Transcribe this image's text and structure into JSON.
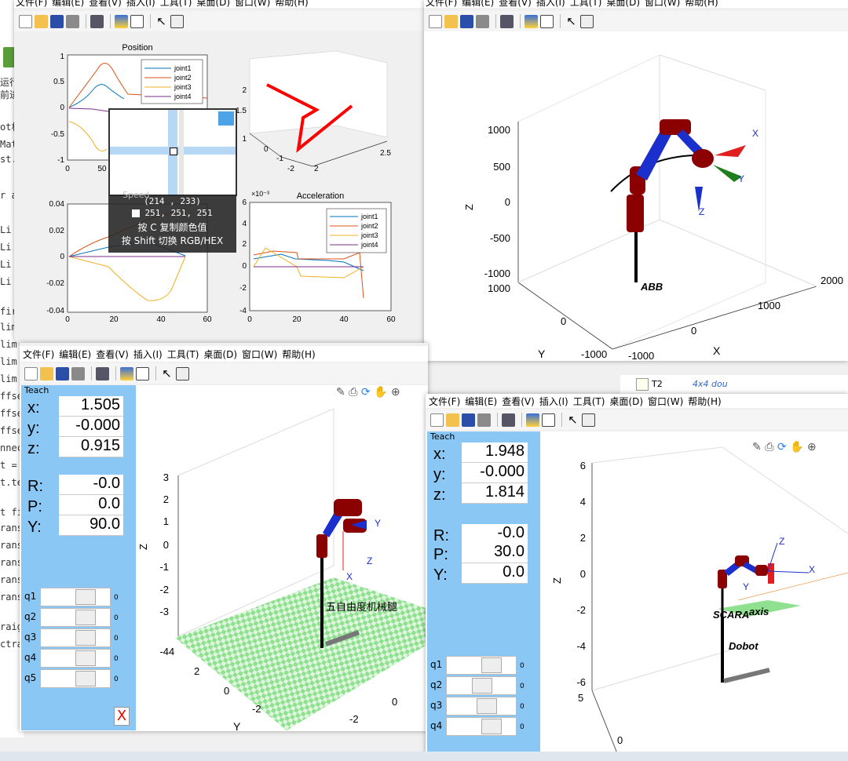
{
  "menu": [
    "文件(F)",
    "编辑(E)",
    "查看(V)",
    "插入(I)",
    "工具(T)",
    "桌面(D)",
    "窗口(W)",
    "帮助(H)"
  ],
  "code_lines": [
    {
      "text": "运行",
      "top": 96
    },
    {
      "text": "前进",
      "top": 112
    },
    {
      "text": "ot机",
      "top": 153
    },
    {
      "text": "Mat",
      "top": 177
    },
    {
      "text": "st.m",
      "top": 196
    },
    {
      "text": "r a",
      "top": 242
    },
    {
      "text": "Li",
      "top": 286
    },
    {
      "text": "Li",
      "top": 308
    },
    {
      "text": "Li",
      "top": 330
    },
    {
      "text": "Li",
      "top": 352
    },
    {
      "text": "fir",
      "top": 390
    },
    {
      "text": "lim",
      "top": 410
    },
    {
      "text": "lim",
      "top": 432
    },
    {
      "text": "lim",
      "top": 454
    },
    {
      "text": "lim",
      "top": 476
    },
    {
      "text": "ffse",
      "top": 498
    },
    {
      "text": "ffse",
      "top": 520
    },
    {
      "text": "ffse",
      "top": 542
    },
    {
      "text": "nnec",
      "top": 564
    },
    {
      "text": "t =",
      "top": 586
    },
    {
      "text": "t.te",
      "top": 608
    },
    {
      "text": "t fi",
      "top": 646
    },
    {
      "text": "rans",
      "top": 666
    },
    {
      "text": "rans",
      "top": 688
    },
    {
      "text": "rans",
      "top": 710
    },
    {
      "text": "rans",
      "top": 732
    },
    {
      "text": "rans",
      "top": 754
    },
    {
      "text": "raig",
      "top": 792
    },
    {
      "text": "ctra",
      "top": 814
    }
  ],
  "workspace": {
    "row1": "T2",
    "row2": "4x4 dou"
  },
  "tooltip": {
    "coords": "(214 , 233)",
    "rgb": "251, 251, 251",
    "line1": "按 C 复制颜色值",
    "line2": "按 Shift 切换 RGB/HEX"
  },
  "plots": {
    "position": {
      "title": "Position",
      "yticks": [
        "1",
        "0.5",
        "0",
        "-0.5",
        "-1"
      ],
      "xticks": [
        "0",
        "50"
      ]
    },
    "speed": {
      "title": "Speed",
      "yticks": [
        "0.04",
        "0.02",
        "0",
        "-0.02",
        "-0.04"
      ],
      "xticks": [
        "0",
        "20",
        "40",
        "60"
      ]
    },
    "accel": {
      "title": "Acceleration",
      "exp": "×10⁻³",
      "yticks": [
        "6",
        "4",
        "2",
        "0",
        "-2",
        "-4"
      ],
      "xticks": [
        "0",
        "20",
        "40",
        "60"
      ]
    },
    "legend": [
      "joint1",
      "joint2",
      "joint3",
      "joint4"
    ],
    "path3d": {
      "zticks": [
        "2",
        "1.5",
        "1"
      ],
      "xticks": [
        "0",
        "-1",
        "-2"
      ],
      "yticks": [
        "2",
        "2.5"
      ]
    }
  },
  "abb": {
    "zticks": [
      "1000",
      "500",
      "0",
      "-500",
      "-1000"
    ],
    "ylabel": "Y",
    "zlabel": "Z",
    "xlabel": "X",
    "yticks": [
      "1000",
      "0",
      "-1000"
    ],
    "xticks": [
      "-1000",
      "0",
      "1000",
      "2000"
    ],
    "name": "ABB",
    "axes": [
      "X",
      "Y",
      "Z"
    ]
  },
  "leg": {
    "teach_title": "Teach",
    "x": "1.505",
    "y": "-0.000",
    "z": "0.915",
    "R": "-0.0",
    "P": "0.0",
    "Yv": "90.0",
    "q": [
      "q1",
      "q2",
      "q3",
      "q4",
      "q5"
    ],
    "qval": "0",
    "close": "X",
    "zticks": [
      "3",
      "2",
      "1",
      "0",
      "-1",
      "-2",
      "-3",
      "-4"
    ],
    "ticks_a": [
      "4",
      "2",
      "0",
      "-2"
    ],
    "ticks_b": [
      "0",
      "-2"
    ],
    "ylabel": "Y",
    "zlabel": "Z",
    "xlabel": "X",
    "name": "五自由度机械腿",
    "axes": [
      "X",
      "Y",
      "Z"
    ]
  },
  "dobot": {
    "teach_title": "Teach",
    "x": "1.948",
    "y": "-0.000",
    "z": "1.814",
    "R": "-0.0",
    "P": "30.0",
    "Yv": "0.0",
    "q": [
      "q1",
      "q2",
      "q3",
      "q4"
    ],
    "qval": "0",
    "zticks": [
      "6",
      "4",
      "2",
      "0",
      "-2",
      "-4",
      "-6"
    ],
    "ticks": [
      "5",
      "0"
    ],
    "zlabel": "Z",
    "name1": "SCARA",
    "name2": "Dobot",
    "label_axis": "axis",
    "axes": [
      "X",
      "Y",
      "Z",
      "X",
      "Y",
      "Z"
    ]
  },
  "colors": {
    "teach": "#8ac7f5",
    "joint1": "#0072bd",
    "joint2": "#d95319",
    "joint3": "#edb120",
    "joint4": "#7e2f8e"
  }
}
